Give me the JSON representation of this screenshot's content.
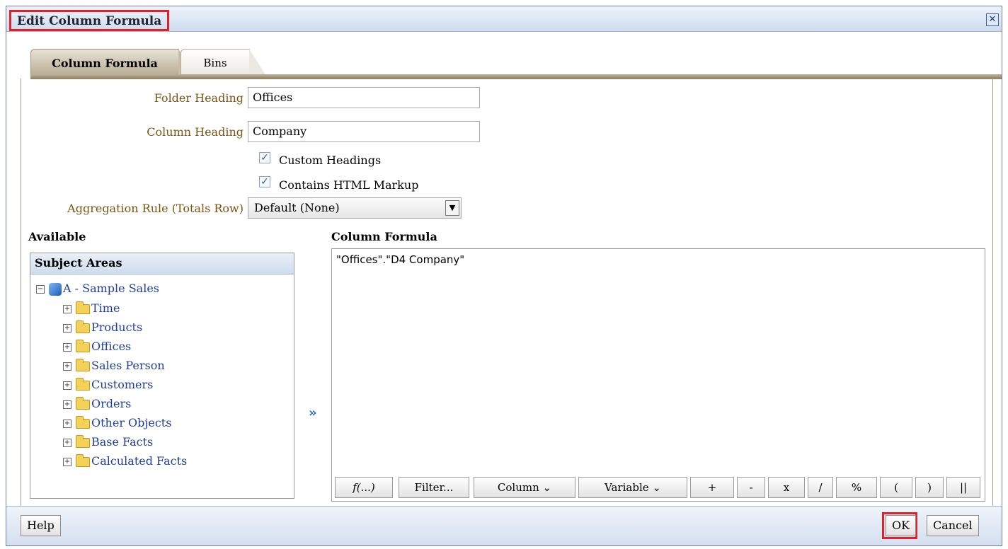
{
  "dialog": {
    "title": "Edit Column Formula",
    "close_label": "✕"
  },
  "tabs": [
    {
      "label": "Column Formula",
      "active": true
    },
    {
      "label": "Bins",
      "active": false
    }
  ],
  "form": {
    "folder_heading_label": "Folder Heading",
    "folder_heading_value": "Offices",
    "column_heading_label": "Column Heading",
    "column_heading_value": "Company",
    "custom_headings_label": "Custom Headings",
    "custom_headings_checked": true,
    "contains_html_label": "Contains HTML Markup",
    "contains_html_checked": true,
    "aggregation_label": "Aggregation Rule (Totals Row)",
    "aggregation_value": "Default (None)"
  },
  "available": {
    "title": "Available",
    "panel_title": "Subject Areas",
    "root": "A - Sample Sales",
    "folders": [
      "Time",
      "Products",
      "Offices",
      "Sales Person",
      "Customers",
      "Orders",
      "Other Objects",
      "Base Facts",
      "Calculated Facts"
    ]
  },
  "formula": {
    "title": "Column Formula",
    "text": "\"Offices\".\"D4  Company\"",
    "buttons": [
      "f(...)",
      "Filter...",
      "Column ⌄",
      "Variable ⌄",
      "+",
      "-",
      "x",
      "/",
      "%",
      "(",
      ")",
      "||"
    ]
  },
  "footer": {
    "help_label": "Help",
    "ok_label": "OK",
    "cancel_label": "Cancel"
  },
  "colors": {
    "label_brown": "#7a5512",
    "tree_blue": "#1f3f9e",
    "highlight_red": "#e0202a"
  }
}
